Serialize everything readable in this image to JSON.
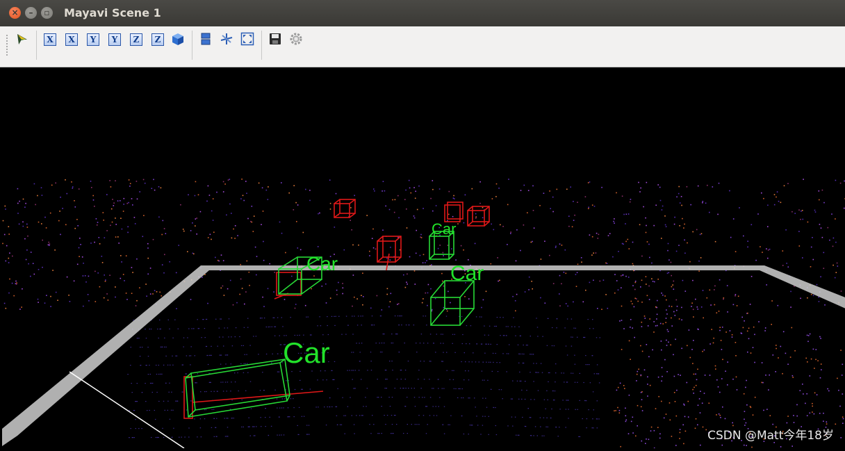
{
  "window": {
    "title": "Mayavi Scene 1"
  },
  "toolbar": {
    "buttons": [
      {
        "name": "mayavi-pipeline-button",
        "icon": "mayavi-logo-icon"
      },
      {
        "name": "view-x-pos-button",
        "icon": "axis-x-icon",
        "glyph": "X"
      },
      {
        "name": "view-x-neg-button",
        "icon": "axis-x-icon",
        "glyph": "X"
      },
      {
        "name": "view-y-pos-button",
        "icon": "axis-y-icon",
        "glyph": "Y"
      },
      {
        "name": "view-y-neg-button",
        "icon": "axis-y-icon",
        "glyph": "Y"
      },
      {
        "name": "view-z-pos-button",
        "icon": "axis-z-icon",
        "glyph": "Z"
      },
      {
        "name": "view-z-neg-button",
        "icon": "axis-z-icon",
        "glyph": "Z"
      },
      {
        "name": "isometric-view-button",
        "icon": "cube-icon"
      },
      {
        "name": "parallel-projection-button",
        "icon": "projection-icon"
      },
      {
        "name": "show-axes-button",
        "icon": "axes-icon"
      },
      {
        "name": "full-screen-button",
        "icon": "fullscreen-icon"
      },
      {
        "name": "save-scene-button",
        "icon": "save-icon"
      },
      {
        "name": "configure-scene-button",
        "icon": "gear-icon"
      }
    ]
  },
  "scene": {
    "labels": [
      "Car",
      "Car",
      "Car",
      "Car"
    ],
    "colors": {
      "prediction_box": "#27d936",
      "ground_truth_box": "#e01818",
      "label": "#22e22a",
      "grid": "#cfcfcf"
    }
  },
  "watermark": "CSDN @Matt今年18岁"
}
